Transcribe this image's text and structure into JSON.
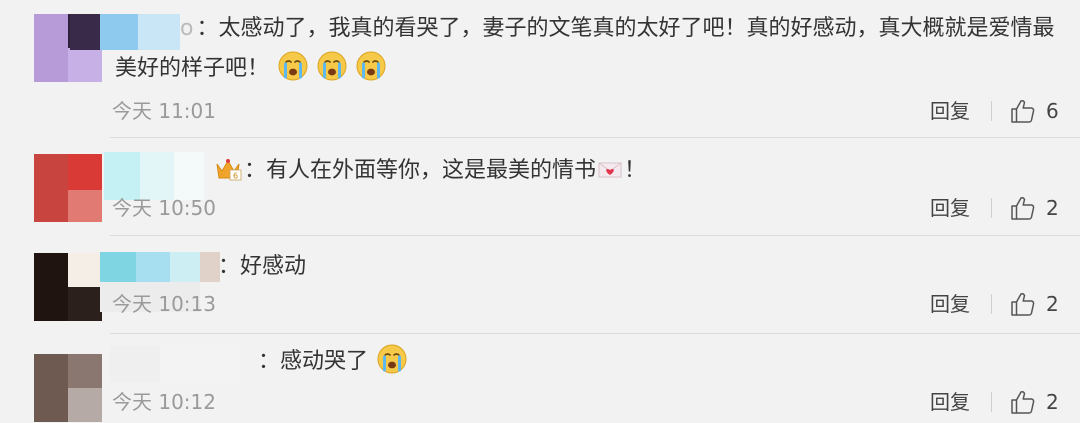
{
  "comments": [
    {
      "user_suffix": "o",
      "text_line1": "：太感动了，我真的看哭了，妻子的文笔真的太好了吧！真的好感动，真大概就是爱情最",
      "text_line2": "美好的样子吧！",
      "time": "今天 11:01",
      "reply_label": "回复",
      "likes": "6",
      "trailing_emojis": [
        "crying-emoji",
        "crying-emoji",
        "crying-emoji"
      ]
    },
    {
      "user_suffix": "",
      "text_before_icon": "：有人在外面等你，这是最美的情书",
      "text_after_icon": "！",
      "time": "今天 10:50",
      "reply_label": "回复",
      "likes": "2",
      "inline_icon": "love-letter-icon",
      "badge_icon": "crown-badge-icon"
    },
    {
      "user_suffix": "",
      "text": "：好感动",
      "time": "今天 10:13",
      "reply_label": "回复",
      "likes": "2"
    },
    {
      "user_suffix": "",
      "text": "：感动哭了",
      "time": "今天 10:12",
      "reply_label": "回复",
      "likes": "2",
      "trailing_emojis": [
        "crying-emoji"
      ]
    }
  ],
  "colors": {
    "background": "#f2f2f2",
    "text": "#333333",
    "time": "#9a9a9a",
    "divider": "#dcdcdc",
    "emoji_yellow": "#f7c948"
  },
  "icons": {
    "like": "thumbs-up-icon"
  }
}
